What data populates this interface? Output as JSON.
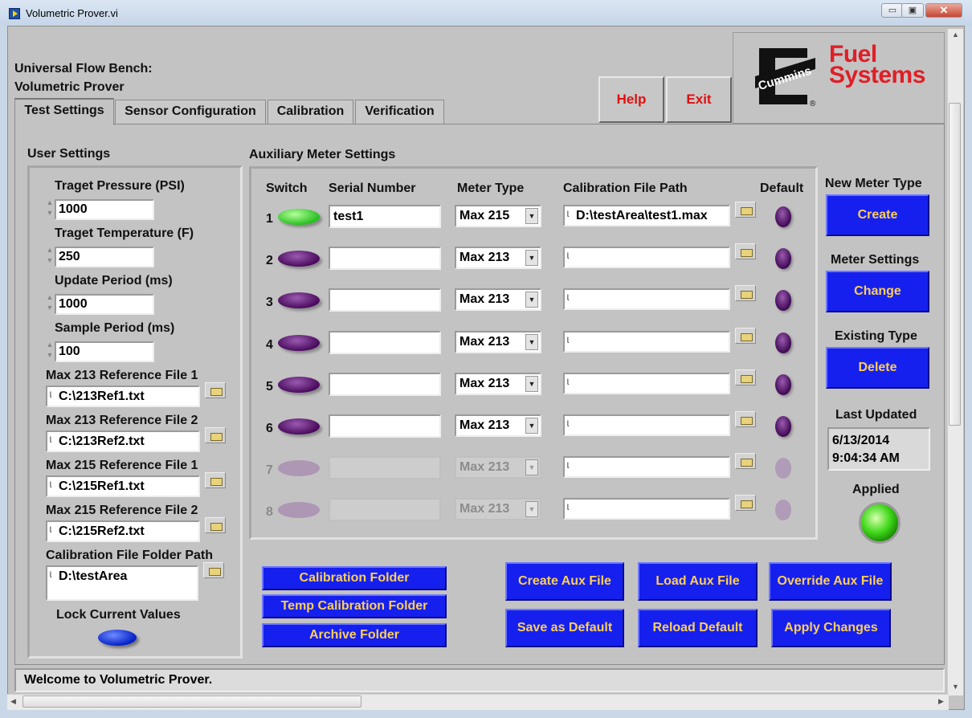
{
  "window": {
    "title": "Volumetric Prover.vi",
    "minimize": "▭",
    "restore": "▣",
    "close": "✕"
  },
  "header": {
    "line1": "Universal Flow Bench:",
    "line2": "Volumetric Prover"
  },
  "buttons_top": {
    "help": "Help",
    "exit": "Exit"
  },
  "logo": {
    "brand": "Cummins",
    "fuel": "Fuel",
    "systems": "Systems",
    "registered": "®"
  },
  "tabs": [
    {
      "label": "Test Settings",
      "active": true
    },
    {
      "label": "Sensor Configuration"
    },
    {
      "label": "Calibration"
    },
    {
      "label": "Verification"
    }
  ],
  "user_settings": {
    "title": "User Settings",
    "target_pressure": {
      "label": "Traget Pressure (PSI)",
      "value": "1000"
    },
    "target_temperature": {
      "label": "Traget Temperature (F)",
      "value": "250"
    },
    "update_period": {
      "label": "Update Period (ms)",
      "value": "1000"
    },
    "sample_period": {
      "label": "Sample Period (ms)",
      "value": "100"
    },
    "ref213_1": {
      "label": "Max 213 Reference File 1",
      "value": "C:\\213Ref1.txt"
    },
    "ref213_2": {
      "label": "Max 213 Reference File 2",
      "value": "C:\\213Ref2.txt"
    },
    "ref215_1": {
      "label": "Max 215 Reference File 1",
      "value": "C:\\215Ref1.txt"
    },
    "ref215_2": {
      "label": "Max 215 Reference File 2",
      "value": "C:\\215Ref2.txt"
    },
    "cal_folder": {
      "label": "Calibration File Folder Path",
      "value": "D:\\testArea"
    },
    "lock": {
      "label": "Lock Current Values",
      "state": "on",
      "color": "#0420c8"
    }
  },
  "aux": {
    "title": "Auxiliary Meter Settings",
    "headers": {
      "switch": "Switch",
      "serial": "Serial Number",
      "type": "Meter Type",
      "path": "Calibration File Path",
      "default": "Default"
    },
    "rows": [
      {
        "num": "1",
        "switch": "on",
        "serial": "test1",
        "type": "Max 215",
        "path": "D:\\testArea\\test1.max",
        "enabled": true
      },
      {
        "num": "2",
        "switch": "off",
        "serial": "",
        "type": "Max 213",
        "path": "",
        "enabled": true
      },
      {
        "num": "3",
        "switch": "off",
        "serial": "",
        "type": "Max 213",
        "path": "",
        "enabled": true
      },
      {
        "num": "4",
        "switch": "off",
        "serial": "",
        "type": "Max 213",
        "path": "",
        "enabled": true
      },
      {
        "num": "5",
        "switch": "off",
        "serial": "",
        "type": "Max 213",
        "path": "",
        "enabled": true
      },
      {
        "num": "6",
        "switch": "off",
        "serial": "",
        "type": "Max 213",
        "path": "",
        "enabled": true
      },
      {
        "num": "7",
        "switch": "off",
        "serial": "",
        "type": "Max 213",
        "path": "",
        "enabled": false
      },
      {
        "num": "8",
        "switch": "off",
        "serial": "",
        "type": "Max 213",
        "path": "",
        "enabled": false
      }
    ]
  },
  "side": {
    "new_meter_type": "New Meter Type",
    "create": "Create",
    "meter_settings": "Meter Settings",
    "change": "Change",
    "existing_type": "Existing Type",
    "delete": "Delete",
    "last_updated_label": "Last Updated",
    "last_updated_date": "6/13/2014",
    "last_updated_time": "9:04:34 AM",
    "applied_label": "Applied",
    "applied_state": "on"
  },
  "folders": {
    "calibration": "Calibration Folder",
    "temp_calibration": "Temp Calibration Folder",
    "archive": "Archive Folder"
  },
  "actions": {
    "create_aux": "Create Aux File",
    "load_aux": "Load Aux  File",
    "override_aux": "Override Aux  File",
    "save_default": "Save as Default",
    "reload_default": "Reload Default",
    "apply": "Apply Changes"
  },
  "status": "Welcome to Volumetric Prover.",
  "colors": {
    "button_blue": "#1520ef",
    "button_text": "#ffcf57",
    "help_text": "#e01010",
    "logo_red": "#e01e26"
  }
}
